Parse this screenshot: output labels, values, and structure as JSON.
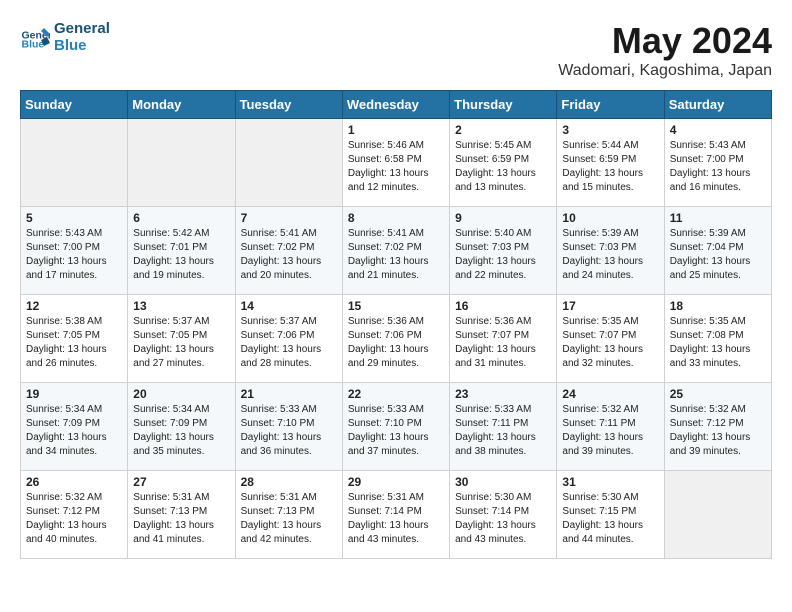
{
  "header": {
    "logo_line1": "General",
    "logo_line2": "Blue",
    "month_title": "May 2024",
    "location": "Wadomari, Kagoshima, Japan"
  },
  "weekdays": [
    "Sunday",
    "Monday",
    "Tuesday",
    "Wednesday",
    "Thursday",
    "Friday",
    "Saturday"
  ],
  "weeks": [
    [
      {
        "day": "",
        "info": ""
      },
      {
        "day": "",
        "info": ""
      },
      {
        "day": "",
        "info": ""
      },
      {
        "day": "1",
        "info": "Sunrise: 5:46 AM\nSunset: 6:58 PM\nDaylight: 13 hours\nand 12 minutes."
      },
      {
        "day": "2",
        "info": "Sunrise: 5:45 AM\nSunset: 6:59 PM\nDaylight: 13 hours\nand 13 minutes."
      },
      {
        "day": "3",
        "info": "Sunrise: 5:44 AM\nSunset: 6:59 PM\nDaylight: 13 hours\nand 15 minutes."
      },
      {
        "day": "4",
        "info": "Sunrise: 5:43 AM\nSunset: 7:00 PM\nDaylight: 13 hours\nand 16 minutes."
      }
    ],
    [
      {
        "day": "5",
        "info": "Sunrise: 5:43 AM\nSunset: 7:00 PM\nDaylight: 13 hours\nand 17 minutes."
      },
      {
        "day": "6",
        "info": "Sunrise: 5:42 AM\nSunset: 7:01 PM\nDaylight: 13 hours\nand 19 minutes."
      },
      {
        "day": "7",
        "info": "Sunrise: 5:41 AM\nSunset: 7:02 PM\nDaylight: 13 hours\nand 20 minutes."
      },
      {
        "day": "8",
        "info": "Sunrise: 5:41 AM\nSunset: 7:02 PM\nDaylight: 13 hours\nand 21 minutes."
      },
      {
        "day": "9",
        "info": "Sunrise: 5:40 AM\nSunset: 7:03 PM\nDaylight: 13 hours\nand 22 minutes."
      },
      {
        "day": "10",
        "info": "Sunrise: 5:39 AM\nSunset: 7:03 PM\nDaylight: 13 hours\nand 24 minutes."
      },
      {
        "day": "11",
        "info": "Sunrise: 5:39 AM\nSunset: 7:04 PM\nDaylight: 13 hours\nand 25 minutes."
      }
    ],
    [
      {
        "day": "12",
        "info": "Sunrise: 5:38 AM\nSunset: 7:05 PM\nDaylight: 13 hours\nand 26 minutes."
      },
      {
        "day": "13",
        "info": "Sunrise: 5:37 AM\nSunset: 7:05 PM\nDaylight: 13 hours\nand 27 minutes."
      },
      {
        "day": "14",
        "info": "Sunrise: 5:37 AM\nSunset: 7:06 PM\nDaylight: 13 hours\nand 28 minutes."
      },
      {
        "day": "15",
        "info": "Sunrise: 5:36 AM\nSunset: 7:06 PM\nDaylight: 13 hours\nand 29 minutes."
      },
      {
        "day": "16",
        "info": "Sunrise: 5:36 AM\nSunset: 7:07 PM\nDaylight: 13 hours\nand 31 minutes."
      },
      {
        "day": "17",
        "info": "Sunrise: 5:35 AM\nSunset: 7:07 PM\nDaylight: 13 hours\nand 32 minutes."
      },
      {
        "day": "18",
        "info": "Sunrise: 5:35 AM\nSunset: 7:08 PM\nDaylight: 13 hours\nand 33 minutes."
      }
    ],
    [
      {
        "day": "19",
        "info": "Sunrise: 5:34 AM\nSunset: 7:09 PM\nDaylight: 13 hours\nand 34 minutes."
      },
      {
        "day": "20",
        "info": "Sunrise: 5:34 AM\nSunset: 7:09 PM\nDaylight: 13 hours\nand 35 minutes."
      },
      {
        "day": "21",
        "info": "Sunrise: 5:33 AM\nSunset: 7:10 PM\nDaylight: 13 hours\nand 36 minutes."
      },
      {
        "day": "22",
        "info": "Sunrise: 5:33 AM\nSunset: 7:10 PM\nDaylight: 13 hours\nand 37 minutes."
      },
      {
        "day": "23",
        "info": "Sunrise: 5:33 AM\nSunset: 7:11 PM\nDaylight: 13 hours\nand 38 minutes."
      },
      {
        "day": "24",
        "info": "Sunrise: 5:32 AM\nSunset: 7:11 PM\nDaylight: 13 hours\nand 39 minutes."
      },
      {
        "day": "25",
        "info": "Sunrise: 5:32 AM\nSunset: 7:12 PM\nDaylight: 13 hours\nand 39 minutes."
      }
    ],
    [
      {
        "day": "26",
        "info": "Sunrise: 5:32 AM\nSunset: 7:12 PM\nDaylight: 13 hours\nand 40 minutes."
      },
      {
        "day": "27",
        "info": "Sunrise: 5:31 AM\nSunset: 7:13 PM\nDaylight: 13 hours\nand 41 minutes."
      },
      {
        "day": "28",
        "info": "Sunrise: 5:31 AM\nSunset: 7:13 PM\nDaylight: 13 hours\nand 42 minutes."
      },
      {
        "day": "29",
        "info": "Sunrise: 5:31 AM\nSunset: 7:14 PM\nDaylight: 13 hours\nand 43 minutes."
      },
      {
        "day": "30",
        "info": "Sunrise: 5:30 AM\nSunset: 7:14 PM\nDaylight: 13 hours\nand 43 minutes."
      },
      {
        "day": "31",
        "info": "Sunrise: 5:30 AM\nSunset: 7:15 PM\nDaylight: 13 hours\nand 44 minutes."
      },
      {
        "day": "",
        "info": ""
      }
    ]
  ]
}
